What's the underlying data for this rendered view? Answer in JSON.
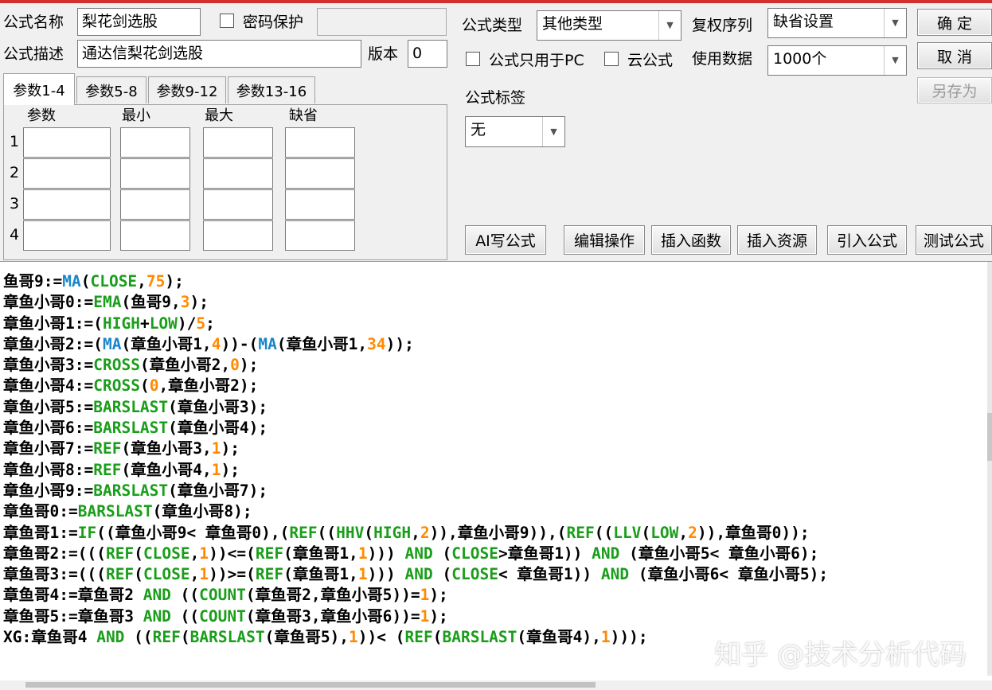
{
  "labels": {
    "name": "公式名称",
    "password": "密码保护",
    "desc": "公式描述",
    "version": "版本",
    "type": "公式类型",
    "fq": "复权序列",
    "pc_only": "公式只用于PC",
    "cloud": "云公式",
    "use_data": "使用数据",
    "tag": "公式标签"
  },
  "fields": {
    "name": "梨花剑选股",
    "desc": "通达信梨花剑选股",
    "version": "0",
    "type": "其他类型",
    "fq": "缺省设置",
    "use_data": "1000个",
    "tag": "无"
  },
  "buttons": {
    "ok": "确 定",
    "cancel": "取 消",
    "save_as": "另存为",
    "ai": "AI写公式",
    "edit": "编辑操作",
    "insert_func": "插入函数",
    "insert_res": "插入资源",
    "import": "引入公式",
    "test": "测试公式"
  },
  "tabs": [
    "参数1-4",
    "参数5-8",
    "参数9-12",
    "参数13-16"
  ],
  "param_headers": [
    "参数",
    "最小",
    "最大",
    "缺省"
  ],
  "param_rows": [
    "1",
    "2",
    "3",
    "4"
  ],
  "code_lines": [
    [
      [
        "鱼哥9:=",
        ""
      ],
      [
        "MA",
        "ma"
      ],
      [
        "(",
        ""
      ],
      [
        "CLOSE",
        "fn"
      ],
      [
        ",",
        ""
      ],
      [
        "75",
        "num"
      ],
      [
        ");",
        ""
      ]
    ],
    [
      [
        "章鱼小哥0:=",
        ""
      ],
      [
        "EMA",
        "fn"
      ],
      [
        "(鱼哥9,",
        ""
      ],
      [
        "3",
        "num"
      ],
      [
        ");",
        ""
      ]
    ],
    [
      [
        "章鱼小哥1:=(",
        ""
      ],
      [
        "HIGH",
        "fn"
      ],
      [
        "+",
        ""
      ],
      [
        "LOW",
        "fn"
      ],
      [
        ")/",
        ""
      ],
      [
        "5",
        "num"
      ],
      [
        ";",
        ""
      ]
    ],
    [
      [
        "章鱼小哥2:=(",
        ""
      ],
      [
        "MA",
        "ma"
      ],
      [
        "(章鱼小哥1,",
        ""
      ],
      [
        "4",
        "num"
      ],
      [
        "))-(",
        ""
      ],
      [
        "MA",
        "ma"
      ],
      [
        "(章鱼小哥1,",
        ""
      ],
      [
        "34",
        "num"
      ],
      [
        "));",
        ""
      ]
    ],
    [
      [
        "章鱼小哥3:=",
        ""
      ],
      [
        "CROSS",
        "fn"
      ],
      [
        "(章鱼小哥2,",
        ""
      ],
      [
        "0",
        "num"
      ],
      [
        ");",
        ""
      ]
    ],
    [
      [
        "章鱼小哥4:=",
        ""
      ],
      [
        "CROSS",
        "fn"
      ],
      [
        "(",
        ""
      ],
      [
        "0",
        "num"
      ],
      [
        ",章鱼小哥2);",
        ""
      ]
    ],
    [
      [
        "章鱼小哥5:=",
        ""
      ],
      [
        "BARSLAST",
        "fn"
      ],
      [
        "(章鱼小哥3);",
        ""
      ]
    ],
    [
      [
        "章鱼小哥6:=",
        ""
      ],
      [
        "BARSLAST",
        "fn"
      ],
      [
        "(章鱼小哥4);",
        ""
      ]
    ],
    [
      [
        "章鱼小哥7:=",
        ""
      ],
      [
        "REF",
        "fn"
      ],
      [
        "(章鱼小哥3,",
        ""
      ],
      [
        "1",
        "num"
      ],
      [
        ");",
        ""
      ]
    ],
    [
      [
        "章鱼小哥8:=",
        ""
      ],
      [
        "REF",
        "fn"
      ],
      [
        "(章鱼小哥4,",
        ""
      ],
      [
        "1",
        "num"
      ],
      [
        ");",
        ""
      ]
    ],
    [
      [
        "章鱼小哥9:=",
        ""
      ],
      [
        "BARSLAST",
        "fn"
      ],
      [
        "(章鱼小哥7);",
        ""
      ]
    ],
    [
      [
        "章鱼哥0:=",
        ""
      ],
      [
        "BARSLAST",
        "fn"
      ],
      [
        "(章鱼小哥8);",
        ""
      ]
    ],
    [
      [
        "章鱼哥1:=",
        ""
      ],
      [
        "IF",
        "fn"
      ],
      [
        "((章鱼小哥9< 章鱼哥0),(",
        ""
      ],
      [
        "REF",
        "fn"
      ],
      [
        "((",
        ""
      ],
      [
        "HHV",
        "fn"
      ],
      [
        "(",
        ""
      ],
      [
        "HIGH",
        "fn"
      ],
      [
        ",",
        ""
      ],
      [
        "2",
        "num"
      ],
      [
        ")),章鱼小哥9)),(",
        ""
      ],
      [
        "REF",
        "fn"
      ],
      [
        "((",
        ""
      ],
      [
        "LLV",
        "fn"
      ],
      [
        "(",
        ""
      ],
      [
        "LOW",
        "fn"
      ],
      [
        ",",
        ""
      ],
      [
        "2",
        "num"
      ],
      [
        ")),章鱼哥0));",
        ""
      ]
    ],
    [
      [
        "章鱼哥2:=(((",
        ""
      ],
      [
        "REF",
        "fn"
      ],
      [
        "(",
        ""
      ],
      [
        "CLOSE",
        "fn"
      ],
      [
        ",",
        ""
      ],
      [
        "1",
        "num"
      ],
      [
        "))<=(",
        ""
      ],
      [
        "REF",
        "fn"
      ],
      [
        "(章鱼哥1,",
        ""
      ],
      [
        "1",
        "num"
      ],
      [
        "))) ",
        ""
      ],
      [
        "AND",
        "kw"
      ],
      [
        " (",
        ""
      ],
      [
        "CLOSE",
        "fn"
      ],
      [
        ">章鱼哥1)) ",
        ""
      ],
      [
        "AND",
        "kw"
      ],
      [
        " (章鱼小哥5< 章鱼小哥6);",
        ""
      ]
    ],
    [
      [
        "章鱼哥3:=(((",
        ""
      ],
      [
        "REF",
        "fn"
      ],
      [
        "(",
        ""
      ],
      [
        "CLOSE",
        "fn"
      ],
      [
        ",",
        ""
      ],
      [
        "1",
        "num"
      ],
      [
        "))>=(",
        ""
      ],
      [
        "REF",
        "fn"
      ],
      [
        "(章鱼哥1,",
        ""
      ],
      [
        "1",
        "num"
      ],
      [
        "))) ",
        ""
      ],
      [
        "AND",
        "kw"
      ],
      [
        " (",
        ""
      ],
      [
        "CLOSE",
        "fn"
      ],
      [
        "< 章鱼哥1)) ",
        ""
      ],
      [
        "AND",
        "kw"
      ],
      [
        " (章鱼小哥6< 章鱼小哥5);",
        ""
      ]
    ],
    [
      [
        "章鱼哥4:=章鱼哥2 ",
        ""
      ],
      [
        "AND",
        "kw"
      ],
      [
        " ((",
        ""
      ],
      [
        "COUNT",
        "fn"
      ],
      [
        "(章鱼哥2,章鱼小哥5))=",
        ""
      ],
      [
        "1",
        "num"
      ],
      [
        ");",
        ""
      ]
    ],
    [
      [
        "章鱼哥5:=章鱼哥3 ",
        ""
      ],
      [
        "AND",
        "kw"
      ],
      [
        " ((",
        ""
      ],
      [
        "COUNT",
        "fn"
      ],
      [
        "(章鱼哥3,章鱼小哥6))=",
        ""
      ],
      [
        "1",
        "num"
      ],
      [
        ");",
        ""
      ]
    ],
    [
      [
        "XG:章鱼哥4 ",
        ""
      ],
      [
        "AND",
        "kw"
      ],
      [
        " ((",
        ""
      ],
      [
        "REF",
        "fn"
      ],
      [
        "(",
        ""
      ],
      [
        "BARSLAST",
        "fn"
      ],
      [
        "(章鱼哥5),",
        ""
      ],
      [
        "1",
        "num"
      ],
      [
        "))< (",
        ""
      ],
      [
        "REF",
        "fn"
      ],
      [
        "(",
        ""
      ],
      [
        "BARSLAST",
        "fn"
      ],
      [
        "(章鱼哥4),",
        ""
      ],
      [
        "1",
        "num"
      ],
      [
        ")));",
        ""
      ]
    ]
  ],
  "watermark": "知乎 @技术分析代码",
  "colors": {
    "function": "#1a9e1a",
    "ma_function": "#1a86c8",
    "number": "#ff8a00"
  }
}
